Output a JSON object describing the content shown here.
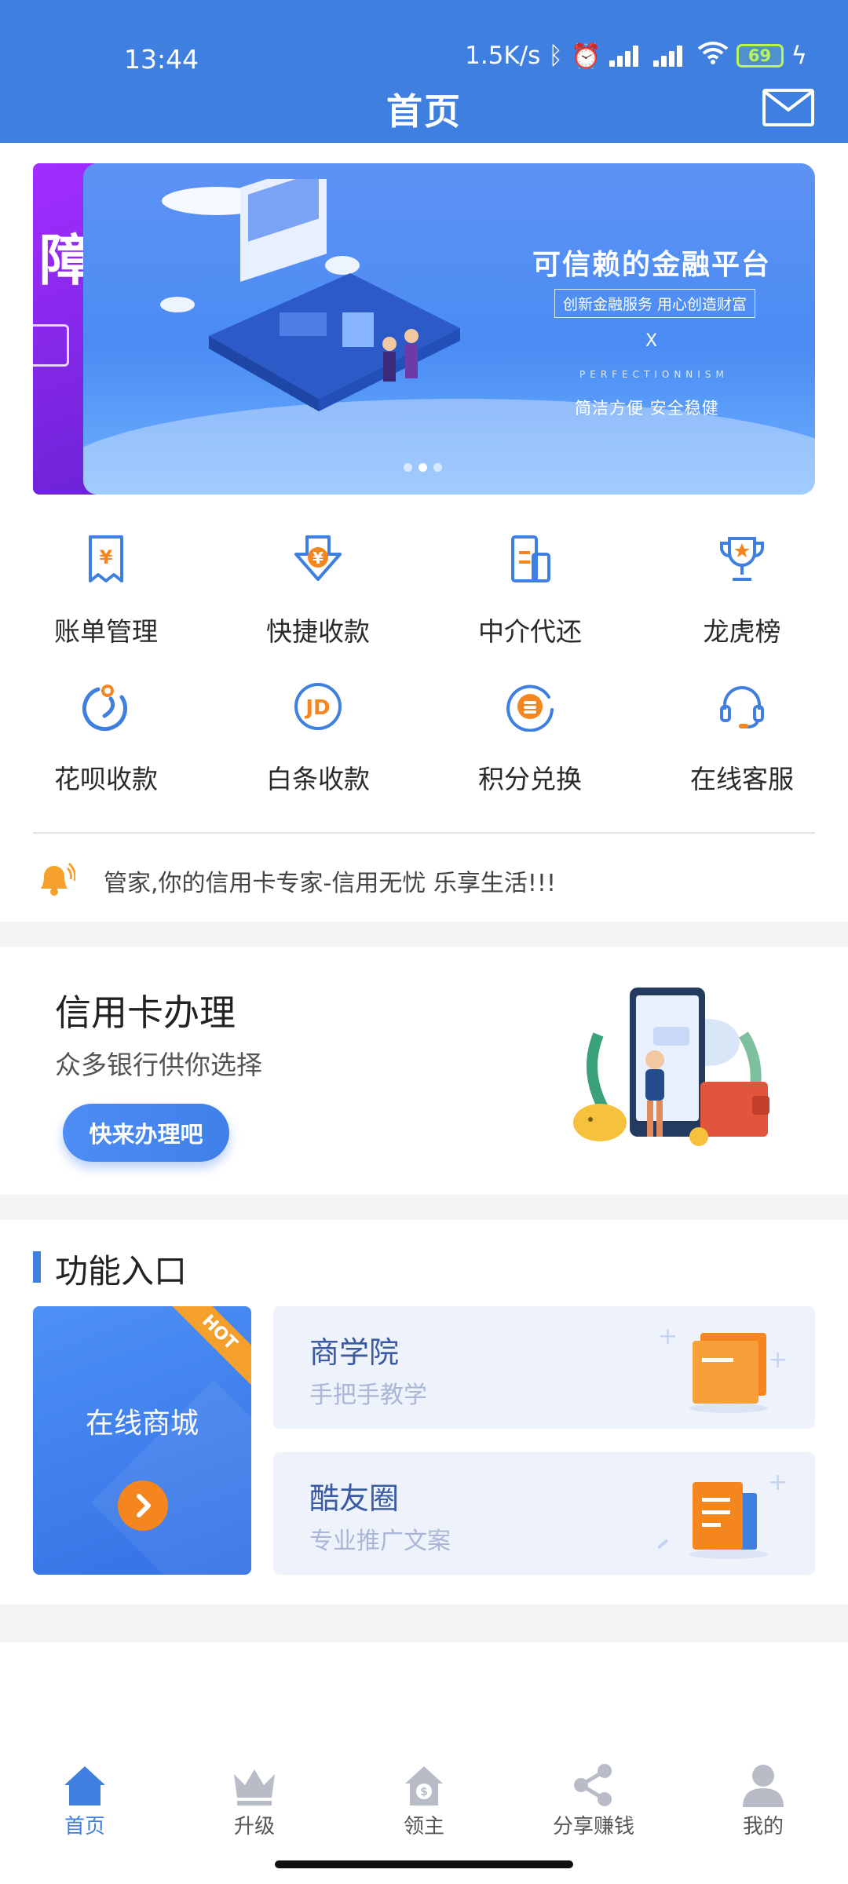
{
  "status_bar": {
    "time": "13:44",
    "speed": "1.5K/s",
    "battery": "69"
  },
  "header": {
    "title": "首页",
    "mail_icon": "mail-icon"
  },
  "banner": {
    "prev_partial_text": "障",
    "title": "可信赖的金融平台",
    "subtitle": "创新金融服务  用心创造财富",
    "separator": "X",
    "english": "PERFECTIONNISM",
    "tagline": "简洁方便   安全稳健",
    "page_count": 3,
    "active_page": 2
  },
  "quick_menu": [
    {
      "label": "账单管理",
      "icon": "bill-icon"
    },
    {
      "label": "快捷收款",
      "icon": "quick-pay-icon"
    },
    {
      "label": "中介代还",
      "icon": "agent-repay-icon"
    },
    {
      "label": "龙虎榜",
      "icon": "trophy-icon"
    },
    {
      "label": "花呗收款",
      "icon": "huabei-icon"
    },
    {
      "label": "白条收款",
      "icon": "jd-icon"
    },
    {
      "label": "积分兑换",
      "icon": "points-icon"
    },
    {
      "label": "在线客服",
      "icon": "headset-icon"
    }
  ],
  "notice": {
    "text": "管家,你的信用卡专家-信用无忧 乐享生活!!!",
    "icon": "bell-icon"
  },
  "credit_card": {
    "title": "信用卡办理",
    "subtitle": "众多银行供你选择",
    "button": "快来办理吧"
  },
  "features": {
    "title": "功能入口",
    "mall": {
      "label": "在线商城",
      "badge": "HOT"
    },
    "tiles": [
      {
        "title": "商学院",
        "subtitle": "手把手教学"
      },
      {
        "title": "酷友圈",
        "subtitle": "专业推广文案"
      }
    ]
  },
  "bottom_nav": [
    {
      "label": "首页",
      "icon": "home-icon",
      "active": true
    },
    {
      "label": "升级",
      "icon": "crown-icon",
      "active": false
    },
    {
      "label": "领主",
      "icon": "lord-icon",
      "active": false
    },
    {
      "label": "分享赚钱",
      "icon": "share-icon",
      "active": false
    },
    {
      "label": "我的",
      "icon": "user-icon",
      "active": false
    }
  ],
  "colors": {
    "primary": "#3e7fe0",
    "accent_orange": "#f5861f",
    "hot_badge": "#f59f2c"
  }
}
